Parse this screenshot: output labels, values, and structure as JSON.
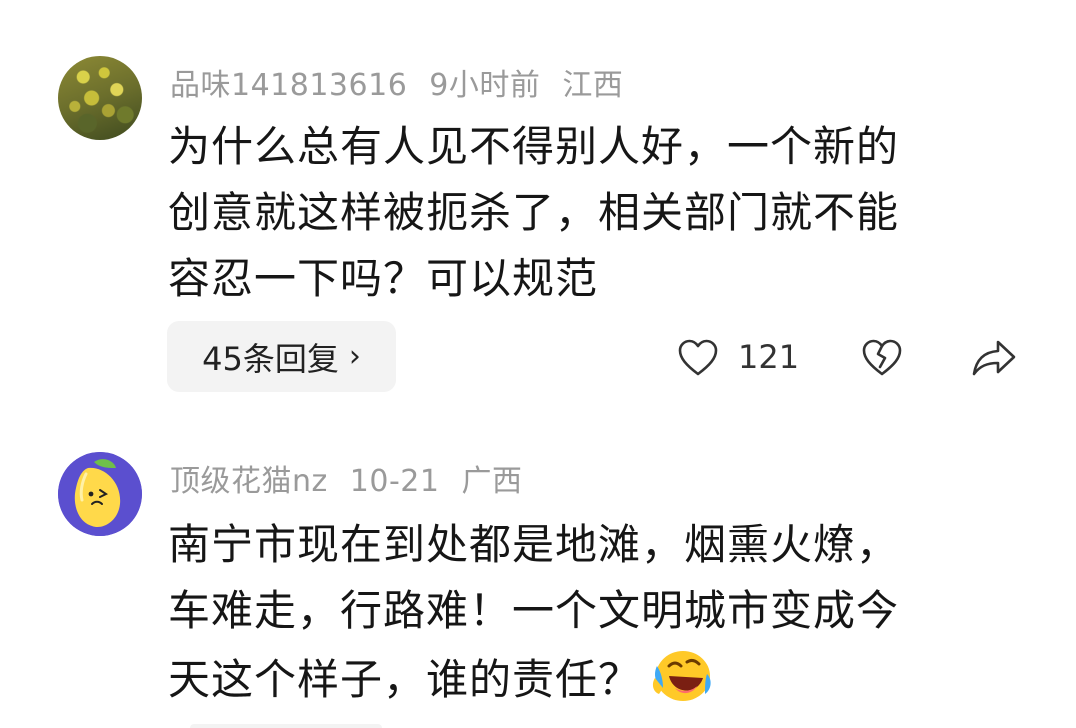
{
  "comments": [
    {
      "username": "品味141813616",
      "time": "9小时前",
      "location": "江西",
      "lines": [
        "为什么总有人见不得别人好，一个新的",
        "创意就这样被扼杀了，相关部门就不能",
        "容忍一下吗？可以规范"
      ],
      "reply_label": "45条回复",
      "like_count": "121",
      "avatar_icon": "flowers-photo"
    },
    {
      "username": "顶级花猫nz",
      "time": "10-21",
      "location": "广西",
      "lines": [
        "南宁市现在到处都是地滩，烟熏火燎，",
        "车难走，行路难！一个文明城市变成今",
        "天这个样子，谁的责任？"
      ],
      "avatar_icon": "lemon-character",
      "inline_emoji": "laughing-crying-emoji"
    }
  ],
  "colors": {
    "meta": "#9a9a9a",
    "text": "#161616",
    "pill_bg": "#f3f3f3",
    "avatar2_bg": "#5b4fcf"
  }
}
